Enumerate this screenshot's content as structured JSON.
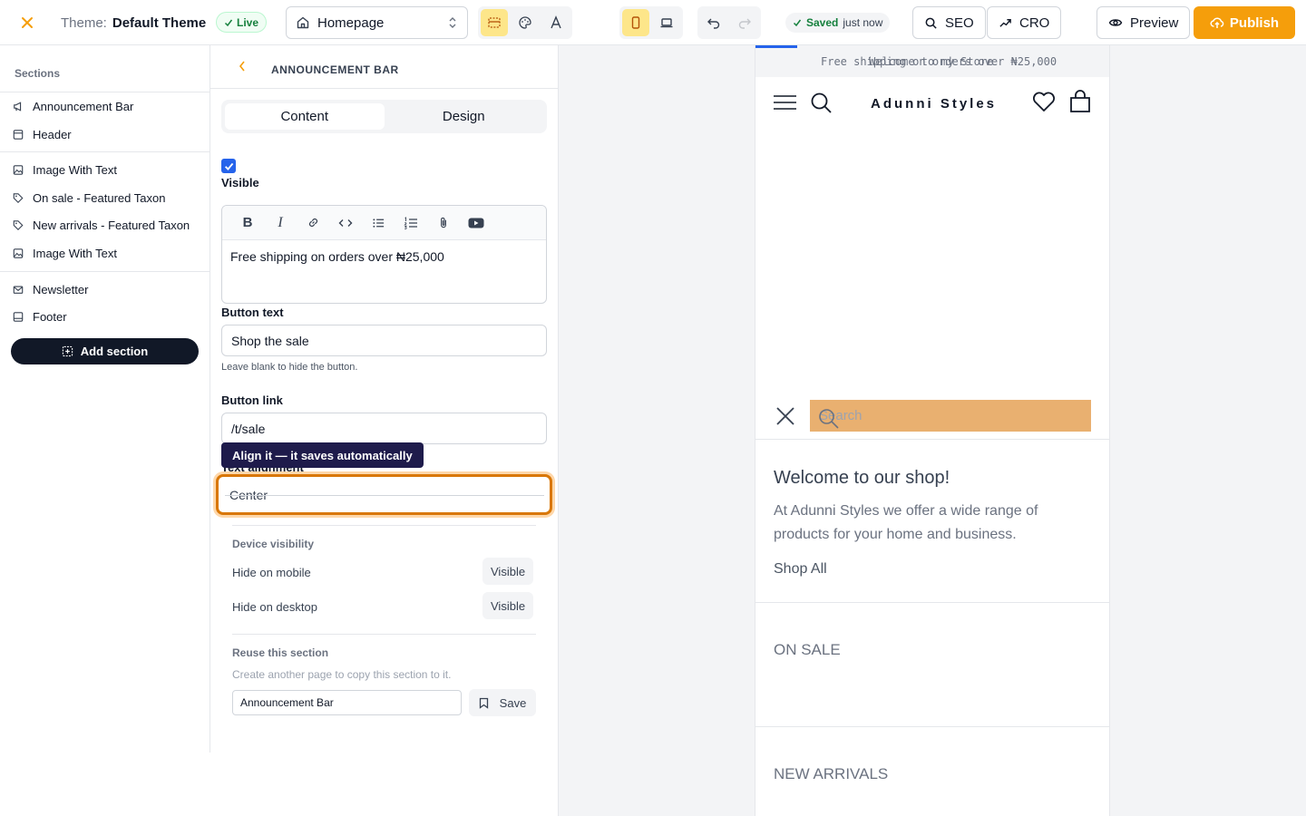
{
  "topbar": {
    "theme_label": "Theme:",
    "theme_name": "Default Theme",
    "live_label": "Live",
    "page_select": "Homepage",
    "saved_label": "Saved",
    "saved_time": "just now",
    "seo_label": "SEO",
    "cro_label": "CRO",
    "preview_label": "Preview",
    "publish_label": "Publish"
  },
  "sidebar": {
    "heading": "Sections",
    "items": [
      {
        "label": "Announcement Bar",
        "icon": "megaphone-icon"
      },
      {
        "label": "Header",
        "icon": "layout-icon"
      },
      {
        "label": "Image With Text",
        "icon": "image-icon"
      },
      {
        "label": "On sale - Featured Taxon",
        "icon": "tag-icon"
      },
      {
        "label": "New arrivals - Featured Taxon",
        "icon": "tag-icon"
      },
      {
        "label": "Image With Text",
        "icon": "image-icon"
      },
      {
        "label": "Newsletter",
        "icon": "mail-icon"
      },
      {
        "label": "Footer",
        "icon": "footer-icon"
      }
    ],
    "add_section_label": "Add section"
  },
  "panel": {
    "title": "ANNOUNCEMENT BAR",
    "tabs": [
      "Content",
      "Design"
    ],
    "visible_label": "Visible",
    "visible_checked": true,
    "editor_text": "Free shipping on orders over ₦25,000",
    "button_text_label": "Button text",
    "button_text_value": "Shop the sale",
    "button_text_help": "Leave blank to hide the button.",
    "button_link_label": "Button link",
    "button_link_value": "/t/sale",
    "tooltip": "Align it — it saves automatically",
    "text_alignment_label": "Text alignment",
    "text_alignment_value": "Center",
    "device_visibility_heading": "Device visibility",
    "hide_mobile_label": "Hide on mobile",
    "hide_mobile_value": "Visible",
    "hide_desktop_label": "Hide on desktop",
    "hide_desktop_value": "Visible",
    "reuse_heading": "Reuse this section",
    "reuse_help": "Create another page to copy this section to it.",
    "reuse_input_value": "Announcement Bar",
    "reuse_save_label": "Save"
  },
  "preview": {
    "announce_text_a": "Free shipping on orders over ₦25,000",
    "announce_text_b": "Welcome to my Store",
    "brand": "Adunni Styles",
    "search_placeholder": "Search",
    "welcome_title": "Welcome to our shop!",
    "welcome_text": "At Adunni Styles we offer a wide range of products for your home and business.",
    "shop_all": "Shop All",
    "on_sale": "ON SALE",
    "new_arrivals": "NEW ARRIVALS"
  },
  "colors": {
    "accent": "#f59e0b",
    "focus": "#d97706",
    "search_fill": "#e9b070",
    "primary_dark": "#111827",
    "checkbox": "#2563eb"
  }
}
